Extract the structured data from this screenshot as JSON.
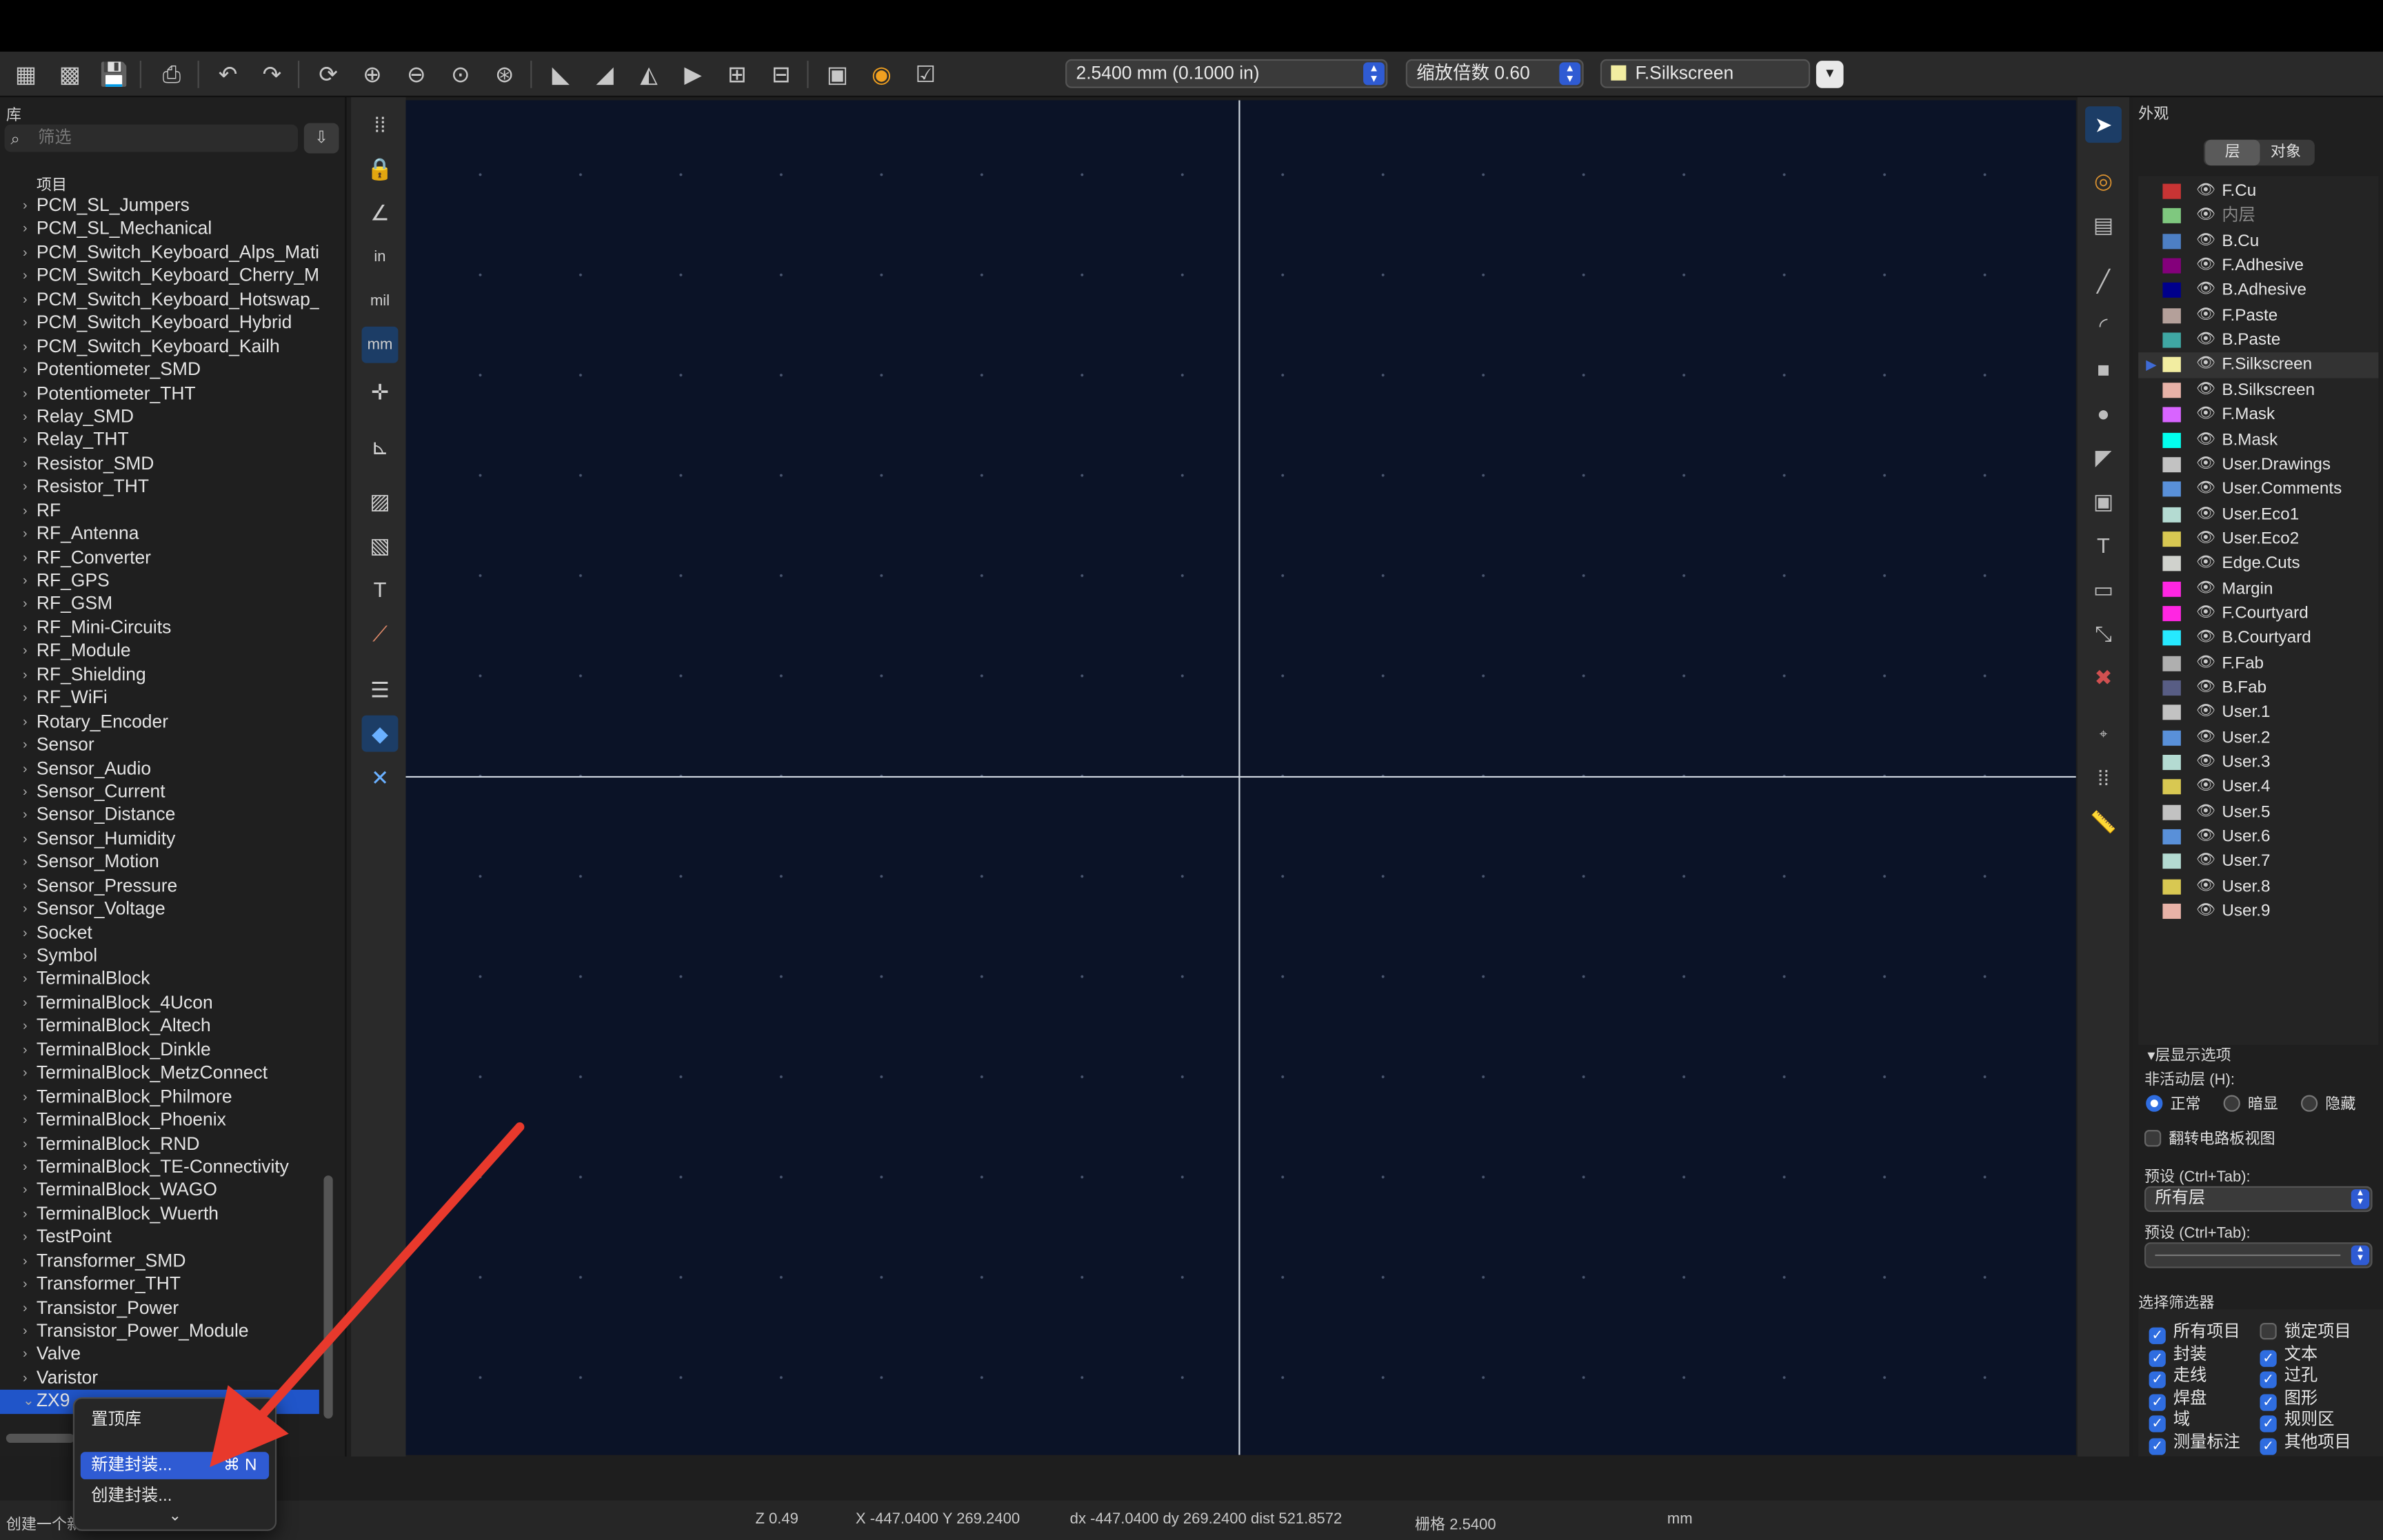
{
  "toolbar": {
    "grid_value": "2.5400 mm (0.1000 in)",
    "zoom_value": "缩放倍数 0.60",
    "layer_value": "F.Silkscreen",
    "icons": [
      "new-footprint-icon",
      "new-from-wizard-icon",
      "save-icon",
      "print-icon",
      "undo-icon",
      "redo-icon",
      "refresh-icon",
      "zoom-in-icon",
      "zoom-out-icon",
      "zoom-fit-icon",
      "zoom-selection-icon",
      "rotate-ccw-icon",
      "rotate-cw-icon",
      "mirror-h-icon",
      "mirror-v-icon",
      "group-icon",
      "ungroup-icon",
      "footprint-properties-icon",
      "pad-settings-icon",
      "check-footprint-icon"
    ]
  },
  "library": {
    "title": "库",
    "search_placeholder": "筛选",
    "column_header": "项目",
    "items": [
      "PCM_SL_Jumpers",
      "PCM_SL_Mechanical",
      "PCM_Switch_Keyboard_Alps_Matias",
      "PCM_Switch_Keyboard_Cherry_MX",
      "PCM_Switch_Keyboard_Hotswap_Kailh",
      "PCM_Switch_Keyboard_Hybrid",
      "PCM_Switch_Keyboard_Kailh",
      "Potentiometer_SMD",
      "Potentiometer_THT",
      "Relay_SMD",
      "Relay_THT",
      "Resistor_SMD",
      "Resistor_THT",
      "RF",
      "RF_Antenna",
      "RF_Converter",
      "RF_GPS",
      "RF_GSM",
      "RF_Mini-Circuits",
      "RF_Module",
      "RF_Shielding",
      "RF_WiFi",
      "Rotary_Encoder",
      "Sensor",
      "Sensor_Audio",
      "Sensor_Current",
      "Sensor_Distance",
      "Sensor_Humidity",
      "Sensor_Motion",
      "Sensor_Pressure",
      "Sensor_Voltage",
      "Socket",
      "Symbol",
      "TerminalBlock",
      "TerminalBlock_4Ucon",
      "TerminalBlock_Altech",
      "TerminalBlock_Dinkle",
      "TerminalBlock_MetzConnect",
      "TerminalBlock_Philmore",
      "TerminalBlock_Phoenix",
      "TerminalBlock_RND",
      "TerminalBlock_TE-Connectivity",
      "TerminalBlock_WAGO",
      "TerminalBlock_Wuerth",
      "TestPoint",
      "Transformer_SMD",
      "Transformer_THT",
      "Transistor_Power",
      "Transistor_Power_Module",
      "Valve",
      "Varistor"
    ],
    "selected_item": "ZX9"
  },
  "context_menu": {
    "pin": "置顶库",
    "new_footprint": "新建封装...",
    "new_shortcut": "⌘ N",
    "create_footprint": "创建封装...",
    "more": "⌄"
  },
  "appearance": {
    "title": "外观",
    "tab_layers": "层",
    "tab_objects": "对象",
    "layers": [
      {
        "name": "F.Cu",
        "color": "#c83434"
      },
      {
        "name": "内层",
        "color": "#7fc87f",
        "dim": true
      },
      {
        "name": "B.Cu",
        "color": "#4d7fc4"
      },
      {
        "name": "F.Adhesive",
        "color": "#84007b"
      },
      {
        "name": "B.Adhesive",
        "color": "#00008b"
      },
      {
        "name": "F.Paste",
        "color": "#b4a09a"
      },
      {
        "name": "B.Paste",
        "color": "#3fa7a3"
      },
      {
        "name": "F.Silkscreen",
        "color": "#f2eda1",
        "active": true
      },
      {
        "name": "B.Silkscreen",
        "color": "#e8b2a7"
      },
      {
        "name": "F.Mask",
        "color": "#d864ff"
      },
      {
        "name": "B.Mask",
        "color": "#02ffee"
      },
      {
        "name": "User.Drawings",
        "color": "#c2c2c2"
      },
      {
        "name": "User.Comments",
        "color": "#5990d9"
      },
      {
        "name": "User.Eco1",
        "color": "#b4dbd2"
      },
      {
        "name": "User.Eco2",
        "color": "#d8c852"
      },
      {
        "name": "Edge.Cuts",
        "color": "#d0d2cd"
      },
      {
        "name": "Margin",
        "color": "#ff26e2"
      },
      {
        "name": "F.Courtyard",
        "color": "#ff26e2"
      },
      {
        "name": "B.Courtyard",
        "color": "#26e9ff"
      },
      {
        "name": "F.Fab",
        "color": "#afafaf"
      },
      {
        "name": "B.Fab",
        "color": "#585d84"
      },
      {
        "name": "User.1",
        "color": "#c2c2c2"
      },
      {
        "name": "User.2",
        "color": "#5990d9"
      },
      {
        "name": "User.3",
        "color": "#b4dbd2"
      },
      {
        "name": "User.4",
        "color": "#d8c852"
      },
      {
        "name": "User.5",
        "color": "#c2c2c2"
      },
      {
        "name": "User.6",
        "color": "#5990d9"
      },
      {
        "name": "User.7",
        "color": "#b4dbd2"
      },
      {
        "name": "User.8",
        "color": "#d8c852"
      },
      {
        "name": "User.9",
        "color": "#e8b2a7"
      }
    ],
    "display_options_title": "▾层显示选项",
    "inactive_layers_label": "非活动层 (H):",
    "opt_normal": "正常",
    "opt_dim": "暗显",
    "opt_hide": "隐藏",
    "flip_board": "翻转电路板视图",
    "preset_label": "预设 (Ctrl+Tab):",
    "preset_value": "所有层",
    "preset_label2": "预设 (Ctrl+Tab):",
    "filter_title": "选择筛选器",
    "filters": [
      {
        "label": "所有项目",
        "checked": true
      },
      {
        "label": "锁定项目",
        "checked": false
      },
      {
        "label": "封装",
        "checked": true
      },
      {
        "label": "文本",
        "checked": true
      },
      {
        "label": "走线",
        "checked": true
      },
      {
        "label": "过孔",
        "checked": true
      },
      {
        "label": "焊盘",
        "checked": true
      },
      {
        "label": "图形",
        "checked": true
      },
      {
        "label": "域",
        "checked": true
      },
      {
        "label": "规则区",
        "checked": true
      },
      {
        "label": "测量标注",
        "checked": true
      },
      {
        "label": "其他项目",
        "checked": true
      }
    ]
  },
  "status": {
    "message": "创建一个新",
    "zoom": "Z 0.49",
    "xy": "X -447.0400  Y 269.2400",
    "delta": "dx -447.0400  dy 269.2400  dist 521.8572",
    "grid": "栅格 2.5400",
    "units": "mm"
  },
  "colors": {
    "canvas_bg": "#0b1327",
    "accent": "#2f5bd3",
    "annotation_arrow": "#e8392c"
  }
}
